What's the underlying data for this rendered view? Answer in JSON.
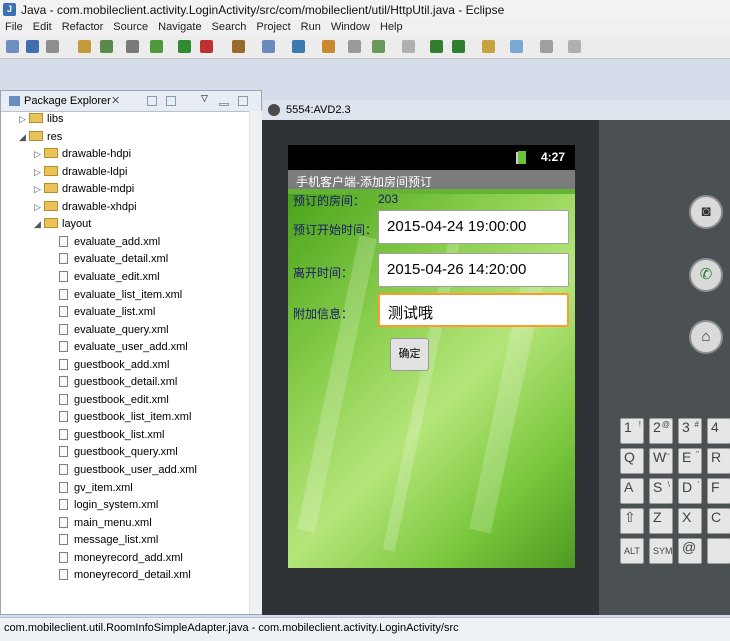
{
  "window": {
    "title": "Java - com.mobileclient.activity.LoginActivity/src/com/mobileclient/util/HttpUtil.java - Eclipse"
  },
  "menu": [
    "File",
    "Edit",
    "Refactor",
    "Source",
    "Navigate",
    "Search",
    "Project",
    "Run",
    "Window",
    "Help"
  ],
  "package_explorer": {
    "tab_label": "Package Explorer",
    "tree": [
      {
        "label": "libs",
        "type": "folder",
        "indent": 1
      },
      {
        "label": "res",
        "type": "folder",
        "indent": 1,
        "expanded": true
      },
      {
        "label": "drawable-hdpi",
        "type": "folder",
        "indent": 2
      },
      {
        "label": "drawable-ldpi",
        "type": "folder",
        "indent": 2
      },
      {
        "label": "drawable-mdpi",
        "type": "folder",
        "indent": 2
      },
      {
        "label": "drawable-xhdpi",
        "type": "folder",
        "indent": 2
      },
      {
        "label": "layout",
        "type": "folder",
        "indent": 2,
        "expanded": true
      },
      {
        "label": "evaluate_add.xml",
        "type": "file",
        "indent": 3
      },
      {
        "label": "evaluate_detail.xml",
        "type": "file",
        "indent": 3
      },
      {
        "label": "evaluate_edit.xml",
        "type": "file",
        "indent": 3
      },
      {
        "label": "evaluate_list_item.xml",
        "type": "file",
        "indent": 3
      },
      {
        "label": "evaluate_list.xml",
        "type": "file",
        "indent": 3
      },
      {
        "label": "evaluate_query.xml",
        "type": "file",
        "indent": 3
      },
      {
        "label": "evaluate_user_add.xml",
        "type": "file",
        "indent": 3
      },
      {
        "label": "guestbook_add.xml",
        "type": "file",
        "indent": 3
      },
      {
        "label": "guestbook_detail.xml",
        "type": "file",
        "indent": 3
      },
      {
        "label": "guestbook_edit.xml",
        "type": "file",
        "indent": 3
      },
      {
        "label": "guestbook_list_item.xml",
        "type": "file",
        "indent": 3
      },
      {
        "label": "guestbook_list.xml",
        "type": "file",
        "indent": 3
      },
      {
        "label": "guestbook_query.xml",
        "type": "file",
        "indent": 3
      },
      {
        "label": "guestbook_user_add.xml",
        "type": "file",
        "indent": 3
      },
      {
        "label": "gv_item.xml",
        "type": "file",
        "indent": 3
      },
      {
        "label": "login_system.xml",
        "type": "file",
        "indent": 3
      },
      {
        "label": "main_menu.xml",
        "type": "file",
        "indent": 3
      },
      {
        "label": "message_list.xml",
        "type": "file",
        "indent": 3
      },
      {
        "label": "moneyrecord_add.xml",
        "type": "file",
        "indent": 3
      },
      {
        "label": "moneyrecord_detail.xml",
        "type": "file",
        "indent": 3
      }
    ]
  },
  "status_bar": "com.mobileclient.util.RoomInfoSimpleAdapter.java - com.mobileclient.activity.LoginActivity/src",
  "emulator": {
    "title": "5554:AVD2.3",
    "clock": "4:27",
    "app_title": "手机客户端-添加房间预订",
    "room_label": "预订的房间：",
    "room_value": "203",
    "start_label": "预订开始时间：",
    "start_value": "2015-04-24 19:00:00",
    "leave_label": "离开时间：",
    "leave_value": "2015-04-26 14:20:00",
    "extra_label": "附加信息：",
    "extra_value": "测试哦",
    "confirm_button": "确定"
  },
  "keyboard_rows": [
    [
      "1",
      "2",
      "3",
      "4"
    ],
    [
      "Q",
      "W",
      "E",
      "R"
    ],
    [
      "A",
      "S",
      "D",
      "F"
    ],
    [
      "⇧",
      "Z",
      "X",
      "C"
    ],
    [
      "ALT",
      "SYM",
      "@",
      ""
    ]
  ],
  "keyboard_sub": [
    [
      "!",
      "@",
      "#",
      ""
    ],
    [
      "",
      "~",
      "\"",
      ""
    ],
    [
      "",
      "\\",
      "'",
      ""
    ],
    [
      "",
      "",
      "",
      ""
    ],
    [
      "",
      "",
      "",
      ""
    ]
  ]
}
